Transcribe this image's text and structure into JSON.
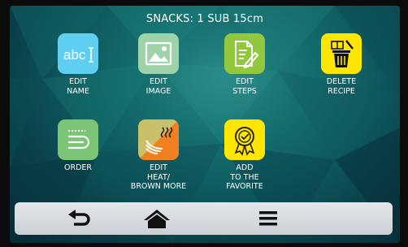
{
  "header": {
    "title": "SNACKS: 1 SUB 15cm"
  },
  "tiles": [
    {
      "label_lines": [
        "EDIT",
        "NAME"
      ],
      "icon": "abc-text-icon",
      "color": "#5ecff0",
      "icon_text": "abc"
    },
    {
      "label_lines": [
        "EDIT",
        "IMAGE"
      ],
      "icon": "image-icon",
      "color": "#9ed3a9"
    },
    {
      "label_lines": [
        "EDIT",
        "STEPS"
      ],
      "icon": "edit-document-icon",
      "color": "#92c83e"
    },
    {
      "label_lines": [
        "DELETE",
        "RECIPE"
      ],
      "icon": "delete-recipe-icon",
      "color": "#ffe600"
    },
    {
      "label_lines": [
        "ORDER"
      ],
      "icon": "order-list-icon",
      "color": "#7cc576"
    },
    {
      "label_lines": [
        "EDIT",
        "HEAT/",
        "BROWN MORE"
      ],
      "icon": "heat-brown-icon",
      "colors": [
        "#c9c06a",
        "#f08020"
      ]
    },
    {
      "label_lines": [
        "ADD",
        "TO THE",
        "FAVORITE"
      ],
      "icon": "favorite-badge-icon",
      "color": "#ffe600"
    }
  ],
  "navbar": {
    "items": [
      {
        "name": "back",
        "icon": "back-arrow-icon"
      },
      {
        "name": "home",
        "icon": "home-icon"
      },
      {
        "name": "menu",
        "icon": "menu-icon"
      }
    ]
  }
}
